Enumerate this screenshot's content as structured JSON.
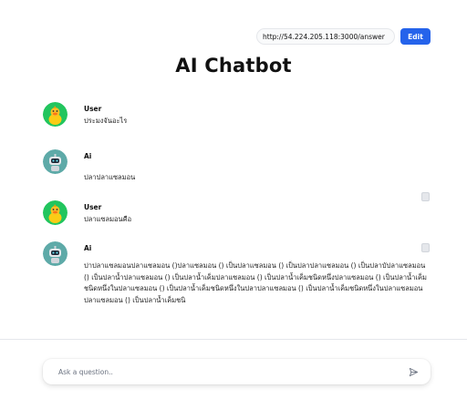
{
  "header": {
    "url_value": "http://54.224.205.118:3000/answer",
    "edit_label": "Edit"
  },
  "title": "AI Chatbot",
  "messages": [
    {
      "sender": "User",
      "text": "ประมงจันอะไร"
    },
    {
      "sender": "Ai",
      "text": "ปลาปลาแซลมอน"
    },
    {
      "sender": "User",
      "text": "ปลาแซลมอนคือ"
    },
    {
      "sender": "Ai",
      "text": "ปาปลาแซลมอนปลาแซลมอน ()ปลาแซลมอน () เป็นปลาแซลมอน () เป็นปลาปลาแซลมอน () เป็นปลาบัปลาแซลมอน () เป็นปลาน้ำปลาแซลมอน () เป็นปลาน้ำเค็มปลาแซลมอน () เป็นปลาน้ำเค็มชนิดหนึ่งปลาแซลมอน () เป็นปลาน้ำเค็มชนิดหนึ่งในปลาแซลมอน () เป็นปลาน้ำเค็มชนิดหนึ่งในปลาปลาแซลมอน () เป็นปลาน้ำเค็มชนิดหนึ่งในปลาแซลมอนปลาแซลมอน () เป็นปลาน้ำเค็มชนิ"
    }
  ],
  "composer": {
    "placeholder": "Ask a question.."
  },
  "icons": {
    "user_avatar": "duck-avatar-icon",
    "ai_avatar": "robot-avatar-icon",
    "copy": "copy-icon",
    "send": "send-icon"
  },
  "colors": {
    "accent": "#2563eb",
    "user_avatar_bg": "#22c55e",
    "ai_avatar_bg": "#5eaaa8"
  }
}
